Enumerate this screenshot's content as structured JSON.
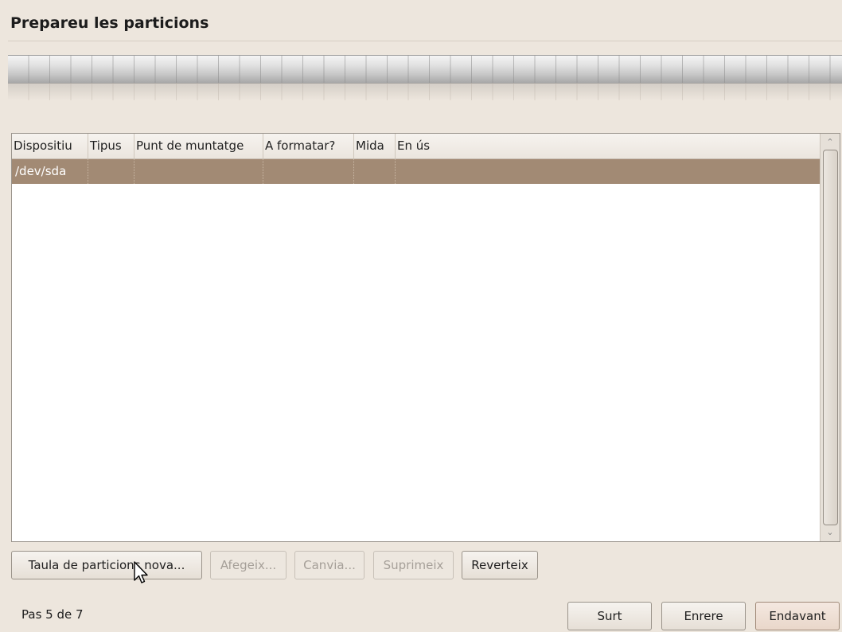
{
  "header": {
    "title": "Prepareu les particions"
  },
  "partition_table": {
    "columns": [
      "Dispositiu",
      "Tipus",
      "Punt de muntatge",
      "A formatar?",
      "Mida",
      "En ús"
    ],
    "rows": [
      {
        "device": "/dev/sda",
        "type": "",
        "mount_point": "",
        "format": "",
        "size": "",
        "used": ""
      }
    ]
  },
  "partition_buttons": {
    "new_table": "Taula de particions nova...",
    "add": "Afegeix...",
    "change": "Canvia...",
    "delete": "Suprimeix",
    "revert": "Reverteix"
  },
  "footer": {
    "step": "Pas 5 de 7",
    "quit": "Surt",
    "back": "Enrere",
    "forward": "Endavant"
  },
  "colors": {
    "background": "#ede6dd",
    "selected_row": "#a28a74"
  }
}
